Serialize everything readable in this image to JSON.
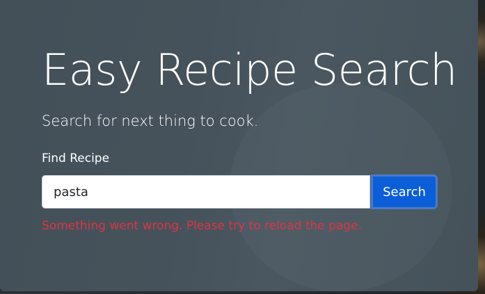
{
  "header": {
    "title": "Easy Recipe Search",
    "subtitle": "Search for next thing to cook."
  },
  "form": {
    "label": "Find Recipe",
    "input_value": "pasta",
    "search_label": "Search"
  },
  "error": "Something went wrong. Please try to reload the page.",
  "colors": {
    "accent": "#0b5ed7",
    "error": "#dc3545"
  }
}
